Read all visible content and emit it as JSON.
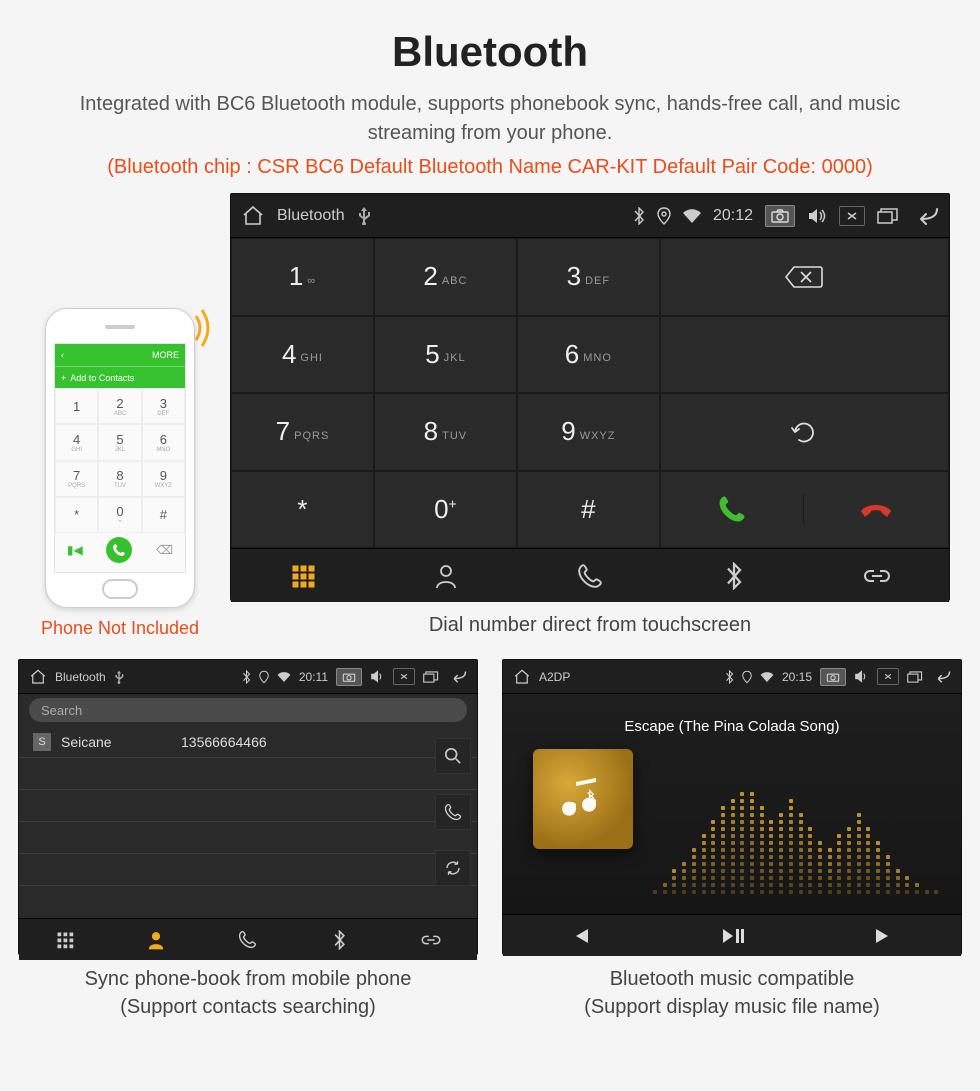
{
  "header": {
    "title": "Bluetooth",
    "subtitle": "Integrated with BC6 Bluetooth module, supports phonebook sync, hands-free call, and music streaming from your phone.",
    "specs": "(Bluetooth chip : CSR BC6    Default Bluetooth Name CAR-KIT    Default Pair Code: 0000)"
  },
  "phone": {
    "topbar_back": "‹",
    "topbar_more": "MORE",
    "add_contacts": "Add to Contacts",
    "keys": [
      {
        "d": "1",
        "s": ""
      },
      {
        "d": "2",
        "s": "ABC"
      },
      {
        "d": "3",
        "s": "DEF"
      },
      {
        "d": "4",
        "s": "GHI"
      },
      {
        "d": "5",
        "s": "JKL"
      },
      {
        "d": "6",
        "s": "MNO"
      },
      {
        "d": "7",
        "s": "PQRS"
      },
      {
        "d": "8",
        "s": "TUV"
      },
      {
        "d": "9",
        "s": "WXYZ"
      },
      {
        "d": "*",
        "s": ""
      },
      {
        "d": "0",
        "s": "+"
      },
      {
        "d": "#",
        "s": ""
      }
    ],
    "caption": "Phone Not Included"
  },
  "hu_main": {
    "statusbar": {
      "title": "Bluetooth",
      "clock": "20:12"
    },
    "keys": [
      {
        "d": "1",
        "s": "∞"
      },
      {
        "d": "2",
        "s": "ABC"
      },
      {
        "d": "3",
        "s": "DEF"
      },
      {
        "d": "4",
        "s": "GHI"
      },
      {
        "d": "5",
        "s": "JKL"
      },
      {
        "d": "6",
        "s": "MNO"
      },
      {
        "d": "7",
        "s": "PQRS"
      },
      {
        "d": "8",
        "s": "TUV"
      },
      {
        "d": "9",
        "s": "WXYZ"
      },
      {
        "d": "*",
        "s": ""
      },
      {
        "d": "0",
        "s": "+",
        "sup": true
      },
      {
        "d": "#",
        "s": ""
      }
    ],
    "caption": "Dial number direct from touchscreen"
  },
  "hu_phonebook": {
    "statusbar": {
      "title": "Bluetooth",
      "clock": "20:11"
    },
    "search_placeholder": "Search",
    "contact": {
      "letter": "S",
      "name": "Seicane",
      "number": "13566664466"
    },
    "caption_line1": "Sync phone-book from mobile phone",
    "caption_line2": "(Support contacts searching)"
  },
  "hu_a2dp": {
    "statusbar": {
      "title": "A2DP",
      "clock": "20:15"
    },
    "track": "Escape (The Pina Colada Song)",
    "eq_heights": [
      3,
      5,
      8,
      12,
      16,
      20,
      24,
      28,
      31,
      34,
      32,
      28,
      24,
      26,
      30,
      27,
      22,
      18,
      15,
      19,
      23,
      26,
      22,
      17,
      13,
      9,
      6,
      4,
      3,
      2
    ],
    "caption_line1": "Bluetooth music compatible",
    "caption_line2": "(Support display music file name)"
  },
  "icons": {
    "keypad": "keypad",
    "contacts": "contacts",
    "calllog": "calllog",
    "bluetooth": "bluetooth",
    "link": "link"
  }
}
